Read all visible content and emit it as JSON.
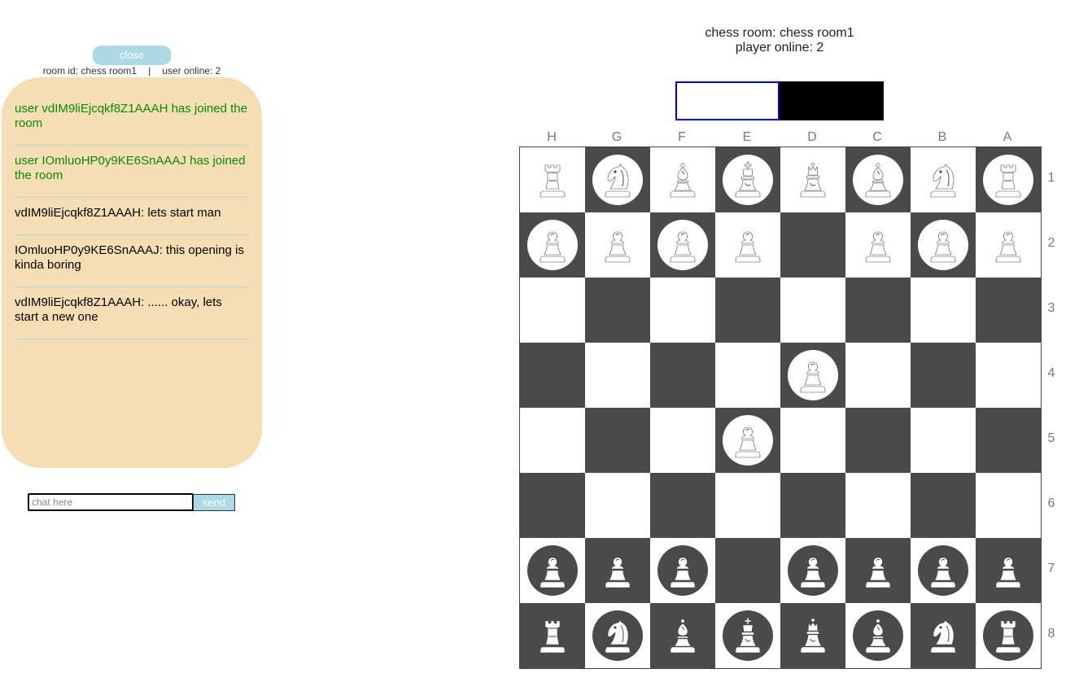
{
  "chat": {
    "close_label": "close",
    "room_id_text": "room id: chess room1",
    "separator": "|",
    "users_online_text": "user online: 2",
    "messages": [
      {
        "type": "system",
        "text": "user vdIM9liEjcqkf8Z1AAAH has joined the room"
      },
      {
        "type": "system",
        "text": "user IOmluoHP0y9KE6SnAAAJ has joined the room"
      },
      {
        "type": "user",
        "text": "vdIM9liEjcqkf8Z1AAAH: lets start man"
      },
      {
        "type": "user",
        "text": "IOmluoHP0y9KE6SnAAAJ: this opening is kinda boring"
      },
      {
        "type": "user",
        "text": "vdIM9liEjcqkf8Z1AAAH: ...... okay, lets start a new one"
      }
    ],
    "input_placeholder": "chat here",
    "input_value": "",
    "send_label": "send",
    "system_color": "#0a8a0a",
    "panel_color": "#f5deb3",
    "button_color": "#add8e6"
  },
  "game": {
    "room_text": "chess room: chess room1",
    "players_text": "player online: 2",
    "turn": {
      "white_active": true,
      "active_border_color": "#0000c8"
    },
    "columns": [
      "H",
      "G",
      "F",
      "E",
      "D",
      "C",
      "B",
      "A"
    ],
    "rows": [
      "1",
      "2",
      "3",
      "4",
      "5",
      "6",
      "7",
      "8"
    ],
    "square_colors": {
      "light": "#ffffff",
      "dark": "#4a4a4a"
    },
    "board": [
      [
        "rook",
        "knight",
        "bishop",
        "king",
        "queen",
        "bishop",
        "knight",
        "rook"
      ],
      [
        "pawn",
        "pawn",
        "pawn",
        "pawn",
        "",
        "pawn",
        "pawn",
        "pawn"
      ],
      [
        "",
        "",
        "",
        "",
        "",
        "",
        "",
        ""
      ],
      [
        "",
        "",
        "",
        "",
        "pawn",
        "",
        "",
        ""
      ],
      [
        "",
        "",
        "",
        "pawn",
        "",
        "",
        "",
        ""
      ],
      [
        "",
        "",
        "",
        "",
        "",
        "",
        "",
        ""
      ],
      [
        "pawn",
        "pawn",
        "pawn",
        "",
        "pawn",
        "pawn",
        "pawn",
        "pawn"
      ],
      [
        "rook",
        "knight",
        "bishop",
        "king",
        "queen",
        "bishop",
        "knight",
        "rook"
      ]
    ]
  }
}
